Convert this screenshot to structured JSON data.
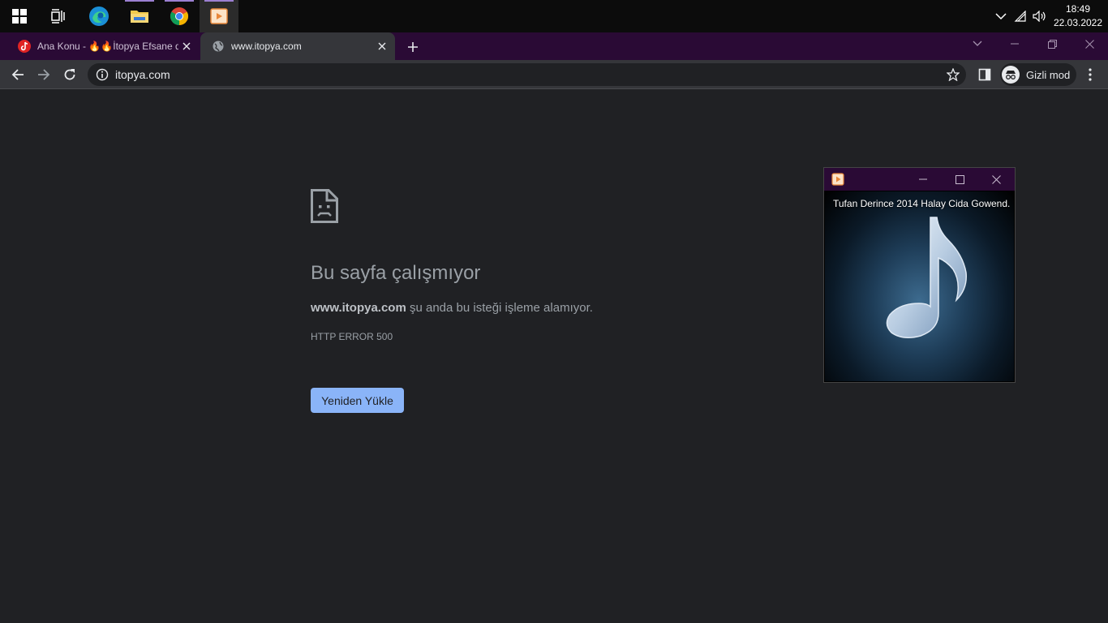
{
  "taskbar": {
    "apps": [
      {
        "name": "start",
        "icon": "windows-logo-icon"
      },
      {
        "name": "task-view",
        "icon": "task-view-icon"
      },
      {
        "name": "edge",
        "icon": "edge-icon"
      },
      {
        "name": "file-explorer",
        "icon": "folder-icon"
      },
      {
        "name": "chrome",
        "icon": "chrome-icon"
      },
      {
        "name": "media-player",
        "icon": "media-player-icon"
      }
    ],
    "time": "18:49",
    "date": "22.03.2022"
  },
  "tabs": [
    {
      "title": "Ana Konu - 🔥🔥İtopya Efsane do",
      "icon": "tiktok-icon",
      "active": false
    },
    {
      "title": "www.itopya.com",
      "icon": "globe-icon",
      "active": true
    }
  ],
  "toolbar": {
    "url": "itopya.com",
    "profile_label": "Gizli mod"
  },
  "error_page": {
    "heading": "Bu sayfa çalışmıyor",
    "domain": "www.itopya.com",
    "description": " şu anda bu isteği işleme alamıyor.",
    "code": "HTTP ERROR 500",
    "reload_label": "Yeniden Yükle"
  },
  "mini_player": {
    "track_title": "Tufan Derince 2014 Halay Cida Gowend..."
  },
  "colors": {
    "page_bg": "#202124",
    "tab_strip": "#2a0a35",
    "reload_button": "#8ab4f8"
  }
}
